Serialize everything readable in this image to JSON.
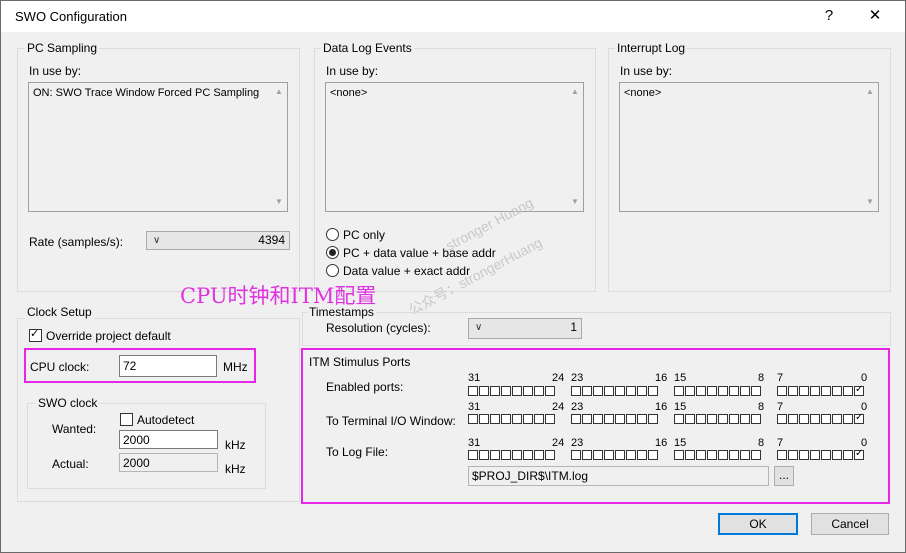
{
  "window": {
    "title": "SWO Configuration",
    "help_glyph": "?",
    "close_glyph": "✕"
  },
  "pc_sampling": {
    "title": "PC Sampling",
    "in_use_label": "In use by:",
    "in_use_value": "ON: SWO Trace Window Forced PC Sampling",
    "rate_label": "Rate (samples/s):",
    "rate_value": "4394"
  },
  "data_log": {
    "title": "Data Log Events",
    "in_use_label": "In use by:",
    "in_use_value": "<none>",
    "options": [
      "PC only",
      "PC + data value + base addr",
      "Data value + exact addr"
    ],
    "selected_index": 1
  },
  "interrupt_log": {
    "title": "Interrupt Log",
    "in_use_label": "In use by:",
    "in_use_value": "<none>"
  },
  "annotation": {
    "text": "CPU时钟和ITM配置",
    "color": "#e033e0"
  },
  "clock_setup": {
    "title": "Clock Setup",
    "override_label": "Override project default",
    "override_checked": true,
    "cpu_clock_label": "CPU clock:",
    "cpu_clock_value": "72",
    "cpu_clock_unit": "MHz",
    "swo_clock": {
      "title": "SWO clock",
      "autodetect_label": "Autodetect",
      "autodetect_checked": false,
      "wanted_label": "Wanted:",
      "wanted_value": "2000",
      "wanted_unit": "kHz",
      "actual_label": "Actual:",
      "actual_value": "2000",
      "actual_unit": "kHz"
    }
  },
  "timestamps": {
    "title": "Timestamps",
    "resolution_label": "Resolution (cycles):",
    "resolution_value": "1"
  },
  "itm": {
    "title": "ITM Stimulus Ports",
    "bit_labels": [
      "31",
      "24",
      "23",
      "16",
      "15",
      "8",
      "7",
      "0"
    ],
    "rows": [
      {
        "label": "Enabled ports:",
        "bit0_checked": true
      },
      {
        "label": "To Terminal I/O Window:",
        "bit0_checked": true
      },
      {
        "label": "To Log File:",
        "bit0_checked": true
      }
    ],
    "log_file_path": "$PROJ_DIR$\\ITM.log",
    "browse_label": "..."
  },
  "buttons": {
    "ok": "OK",
    "cancel": "Cancel"
  },
  "watermark": {
    "line1": "stronger Huang",
    "line2": "公众号：strongerHuang"
  },
  "colors": {
    "highlight": "#e627e6",
    "default_button_border": "#0078d7"
  }
}
